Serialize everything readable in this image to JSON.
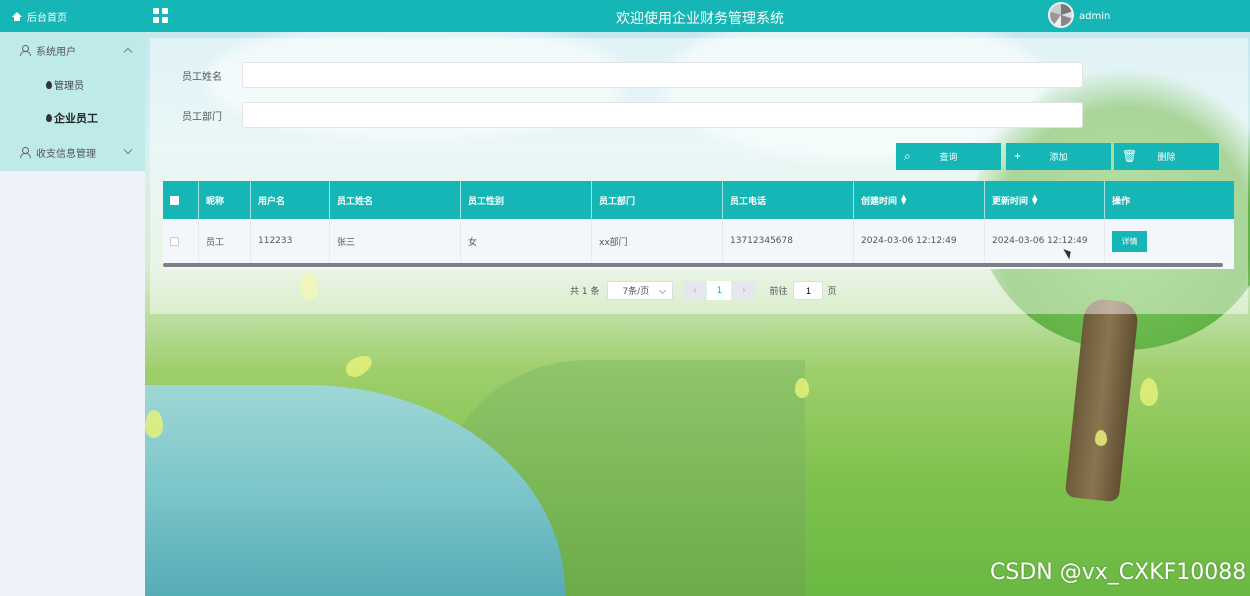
{
  "header": {
    "title": "欢迎使用企业财务管理系统",
    "username": "admin"
  },
  "sidebar": {
    "home": "后台首页",
    "groups": [
      {
        "label": "系统用户",
        "items": [
          "管理员",
          "企业员工"
        ]
      },
      {
        "label": "收支信息管理",
        "items": []
      }
    ]
  },
  "search": {
    "name_label": "员工姓名",
    "dept_label": "员工部门",
    "name_value": "",
    "dept_value": "",
    "btn_query": "查询",
    "btn_add": "添加",
    "btn_delete": "删除"
  },
  "table": {
    "columns": [
      "昵称",
      "用户名",
      "员工姓名",
      "员工性别",
      "员工部门",
      "员工电话",
      "创建时间",
      "更新时间",
      "操作"
    ],
    "rows": [
      [
        "员工",
        "112233",
        "张三",
        "女",
        "xx部门",
        "13712345678",
        "2024-03-06 12:12:49",
        "2024-03-06 12:12:49",
        "详情"
      ]
    ]
  },
  "pagination": {
    "total": "共 1 条",
    "page_size": "7条/页",
    "current": "1",
    "goto_label": "前往",
    "goto_value": "1",
    "page_suffix": "页"
  },
  "watermark": "CSDN @vx_CXKF10088",
  "colors": {
    "accent": "#16b6b6",
    "sidebar_bg": "#eef3fb",
    "menu_bg": "#bfeaea"
  }
}
